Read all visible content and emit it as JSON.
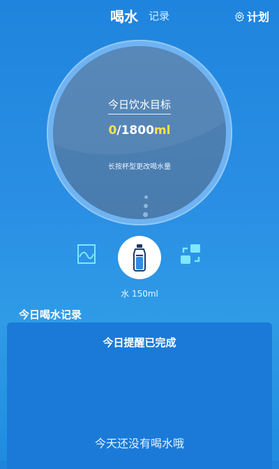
{
  "header": {
    "active_tab": "喝水",
    "inactive_tab": "记录",
    "plan_label": "计划",
    "plan_icon": "gear-icon"
  },
  "goal": {
    "label": "今日饮水目标",
    "current": "0",
    "target": "/1800",
    "unit": "ml",
    "hint": "长按杯型更改喝水量"
  },
  "cup": {
    "label": "水 150ml",
    "left_icon": "image-frame-icon",
    "center_icon": "water-bottle-icon",
    "right_icon": "switch-cup-icon"
  },
  "records": {
    "title": "今日喝水记录",
    "reminder_status": "今日提醒已完成",
    "empty_message": "今天还没有喝水哦"
  },
  "colors": {
    "accent_yellow": "#ffe24a",
    "icon_cyan": "#7fe7ff",
    "background_blue": "#2a8fe4"
  }
}
